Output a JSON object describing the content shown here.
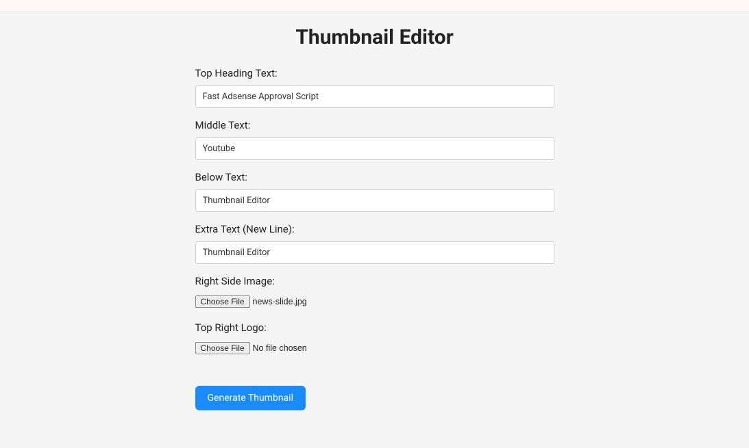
{
  "header": {
    "title": "Thumbnail Editor"
  },
  "form": {
    "top_heading": {
      "label": "Top Heading Text:",
      "value": "Fast Adsense Approval Script"
    },
    "middle_text": {
      "label": "Middle Text:",
      "value": "Youtube"
    },
    "below_text": {
      "label": "Below Text:",
      "value": "Thumbnail Editor"
    },
    "extra_text": {
      "label": "Extra Text (New Line):",
      "value": "Thumbnail Editor"
    },
    "right_image": {
      "label": "Right Side Image:",
      "button": "Choose File",
      "filename": "news-slide.jpg"
    },
    "top_right_logo": {
      "label": "Top Right Logo:",
      "button": "Choose File",
      "filename": "No file chosen"
    },
    "generate": {
      "label": "Generate Thumbnail"
    }
  }
}
